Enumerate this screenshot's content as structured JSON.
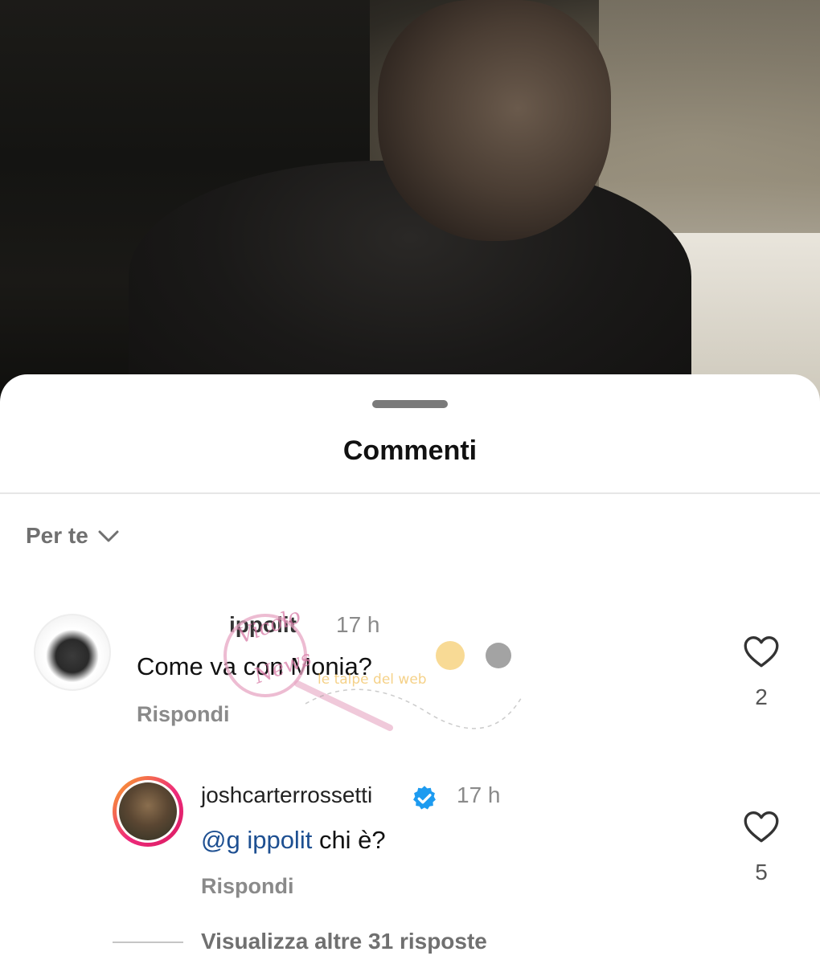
{
  "sheet": {
    "title": "Commenti"
  },
  "sort": {
    "label": "Per te"
  },
  "comments": [
    {
      "username": "ippolit",
      "time": "17 h",
      "text": "Come va con Monia?",
      "reply_label": "Rispondi",
      "likes": "2"
    }
  ],
  "reply": {
    "username": "joshcarterrossetti",
    "verified": true,
    "time": "17 h",
    "mention": "@g        ippolit",
    "text": " chi è?",
    "reply_label": "Rispondi",
    "likes": "5"
  },
  "more_replies": "Visualizza altre 31 risposte",
  "watermark": {
    "brand": "Vicolo delle News",
    "tagline": "le talpe del web"
  },
  "colors": {
    "verified": "#1d9bf0",
    "story_ring_start": "#f9a825",
    "story_ring_end": "#d81b60"
  }
}
